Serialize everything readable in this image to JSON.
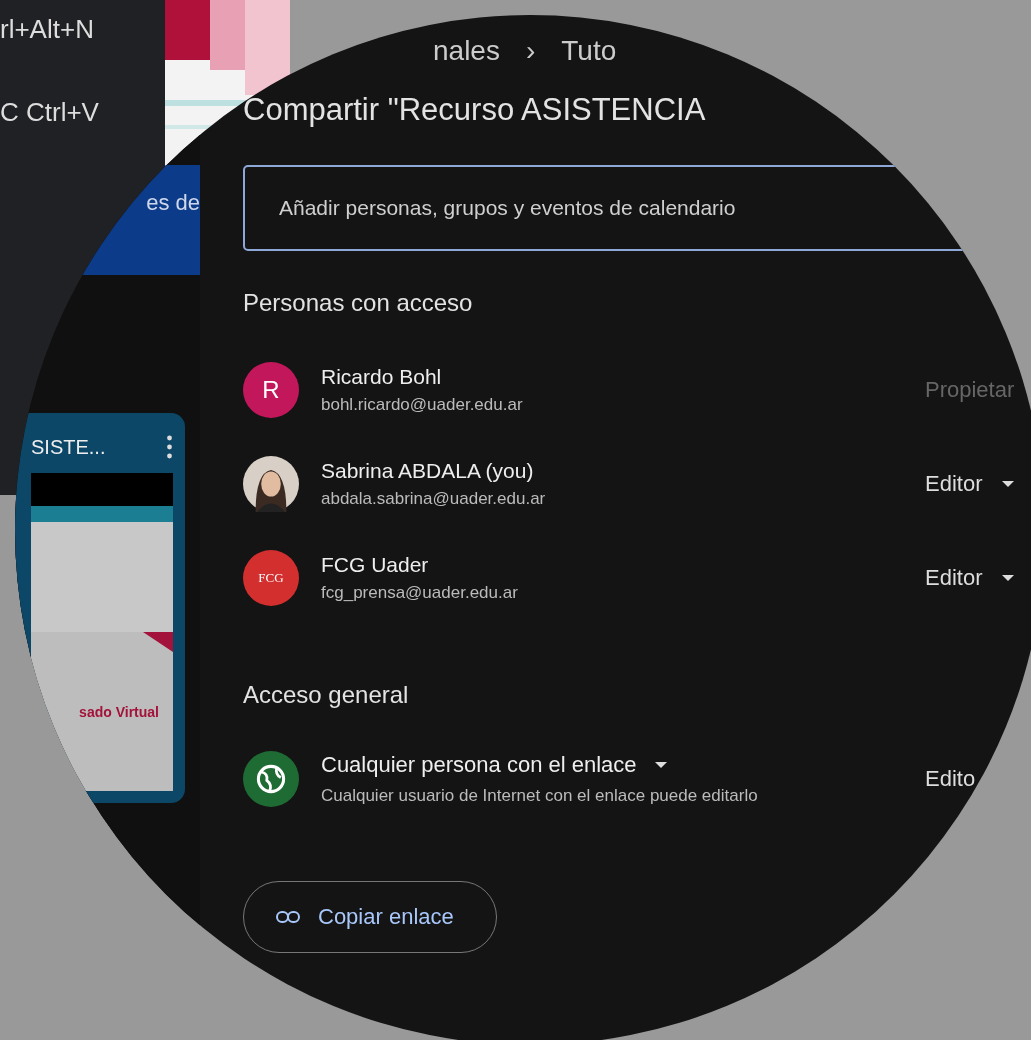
{
  "background_menu": {
    "items": [
      {
        "shortcut": "rl+Alt+N"
      },
      {
        "shortcut": "C Ctrl+V"
      }
    ]
  },
  "breadcrumb": [
    "nales",
    "›",
    "Tuto"
  ],
  "sidebar": {
    "banner": "es de",
    "file_card": {
      "title": "SISTE...",
      "thumbnail_text": "sado Virtual"
    }
  },
  "dialog": {
    "title": "Compartir \"Recurso ASISTENCIA",
    "search": {
      "placeholder": "Añadir personas, grupos y eventos de calendario"
    },
    "people_heading": "Personas con acceso",
    "people": [
      {
        "name": "Ricardo Bohl",
        "email": "bohl.ricardo@uader.edu.ar",
        "role": "Propietar",
        "dropdown": false,
        "avatar": {
          "kind": "letter",
          "letter": "R",
          "color": "#c2185b"
        }
      },
      {
        "name": "Sabrina ABDALA (you)",
        "email": "abdala.sabrina@uader.edu.ar",
        "role": "Editor",
        "dropdown": true
      },
      {
        "name": "FCG Uader",
        "email": "fcg_prensa@uader.edu.ar",
        "role": "Editor",
        "dropdown": true,
        "avatar": {
          "kind": "logo",
          "letter": "FCG",
          "color": "#d32f2f"
        }
      }
    ],
    "general_heading": "Acceso general",
    "general_access": {
      "label": "Cualquier persona con el enlace",
      "dropdown": true,
      "description": "Cualquier usuario de Internet con el enlace puede editarlo",
      "role": "Edito"
    },
    "copy_link": "Copiar enlace"
  }
}
